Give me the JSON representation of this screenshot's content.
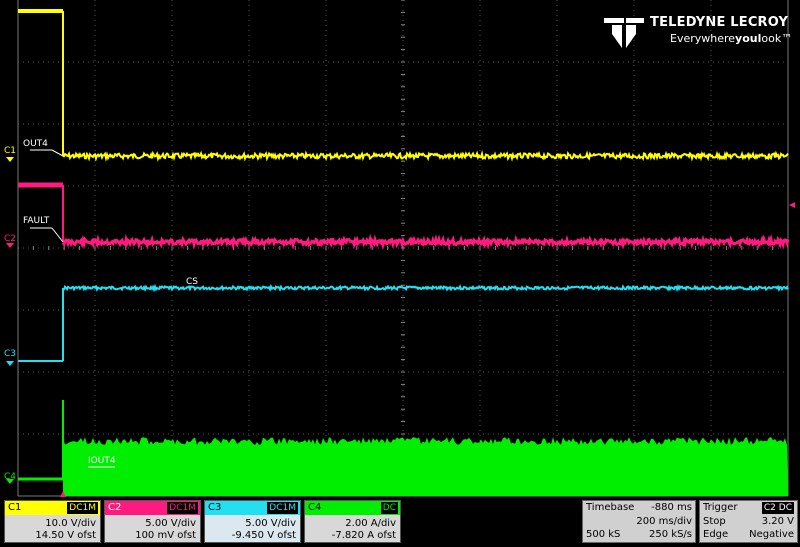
{
  "logo": {
    "brand": "TELEDYNE LECROY",
    "tagline_pre": "Everywhere",
    "tagline_bold": "youl",
    "tagline_post": "ook™"
  },
  "colors": {
    "c1": "#ffff00",
    "c2": "#ff1a7f",
    "c3": "#22e0f0",
    "c4": "#00ee00",
    "grid": "#555555",
    "background": "#000000"
  },
  "channel_markers": [
    {
      "label": "C1",
      "color": "#ffff00"
    },
    {
      "label": "C2",
      "color": "#ff1a7f"
    },
    {
      "label": "C3",
      "color": "#22e0f0"
    },
    {
      "label": "C4",
      "color": "#00ee00"
    }
  ],
  "trace_labels": {
    "out4": "OUT4",
    "fault": "FAULT",
    "cs": "CS",
    "iout4": "IOUT4"
  },
  "channels": [
    {
      "name": "C1",
      "coupling": "DC1M",
      "vdiv": "10.0 V/div",
      "offset": "14.50 V ofst",
      "color": "#ffff00"
    },
    {
      "name": "C2",
      "coupling": "DC1M",
      "vdiv": "5.00 V/div",
      "offset": "100 mV ofst",
      "color": "#ff1a7f"
    },
    {
      "name": "C3",
      "coupling": "DC1M",
      "vdiv": "5.00 V/div",
      "offset": "-9.450 V ofst",
      "color": "#22e0f0"
    },
    {
      "name": "C4",
      "coupling": "DC",
      "vdiv": "2.00 A/div",
      "offset": "-7.820 A ofst",
      "color": "#00ee00"
    }
  ],
  "timebase": {
    "label": "Timebase",
    "delay": "-880 ms",
    "tdiv": "200 ms/div",
    "samples": "500 kS",
    "rate": "250 kS/s"
  },
  "trigger": {
    "label": "Trigger",
    "source": "C2",
    "coupling": "DC",
    "mode": "Stop",
    "level": "3.20 V",
    "type": "Edge",
    "slope": "Negative"
  }
}
